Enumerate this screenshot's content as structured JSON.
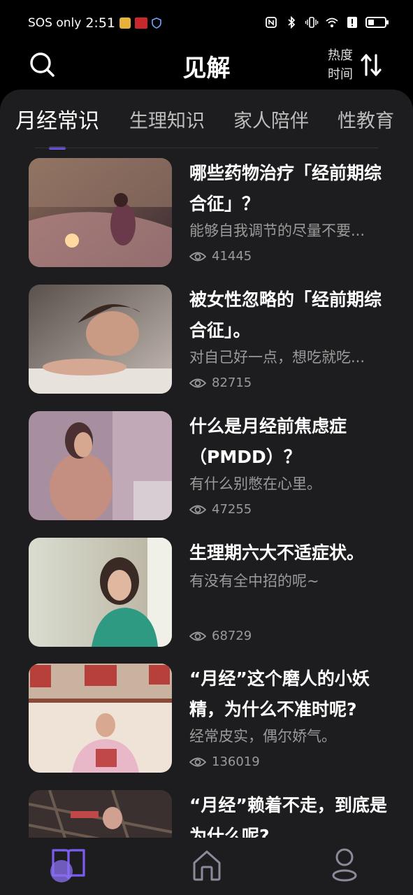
{
  "status_bar": {
    "carrier": "SOS only",
    "time": "2:51",
    "battery_level": 0.35
  },
  "header": {
    "title": "见解",
    "sort_hot": "热度",
    "sort_time": "时间",
    "icons": [
      "search-icon",
      "sort-icon"
    ]
  },
  "tabs": [
    "月经常识",
    "生理知识",
    "家人陪伴",
    "性教育"
  ],
  "active_tab": "月经常识",
  "colors": {
    "accent": "#7b5cf0",
    "panel": "#1d1d1f",
    "background": "#000000",
    "muted_text": "#9a9a9a"
  },
  "articles": [
    {
      "title": "哪些药物治疗「经前期综合征」？",
      "desc": "能够自我调节的尽量不要...",
      "views": "41445"
    },
    {
      "title": "被女性忽略的「经前期综合征」。",
      "desc": "对自己好一点，想吃就吃...",
      "views": "82715"
    },
    {
      "title": "什么是月经前焦虑症（PMDD）？",
      "desc": "有什么别憋在心里。",
      "views": "47255"
    },
    {
      "title": "生理期六大不适症状。",
      "desc": "有没有全中招的呢~",
      "views": "68729"
    },
    {
      "title": "“月经”这个磨人的小妖精，为什么不准时呢?",
      "desc": "经常皮实，偶尔娇气。",
      "views": "136019"
    },
    {
      "title": "“月经”赖着不走，到底是为什么呢?",
      "desc": "",
      "views": ""
    }
  ],
  "bottom_nav": [
    "book-icon",
    "home-icon",
    "profile-icon"
  ],
  "active_nav": "book-icon"
}
